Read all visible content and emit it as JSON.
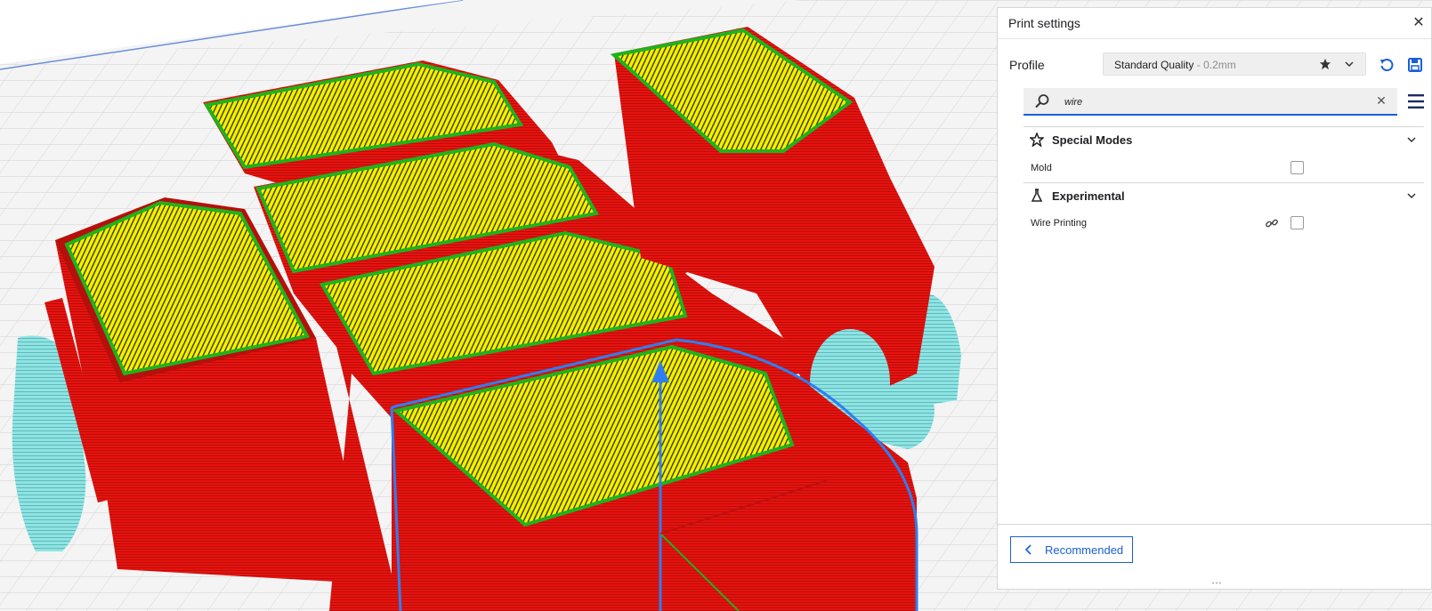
{
  "panel": {
    "title": "Print settings",
    "close_icon": "close-icon"
  },
  "profile": {
    "label": "Profile",
    "name": "Standard Quality",
    "sub": "- 0.2mm",
    "icons": [
      "star-icon",
      "chevron-down-icon",
      "reset-icon",
      "save-icon"
    ]
  },
  "search": {
    "value": "wire",
    "icon": "search-icon"
  },
  "sections": [
    {
      "title": "Special Modes",
      "icon": "star-outline-icon",
      "settings": [
        {
          "label": "Mold",
          "checked": false
        }
      ]
    },
    {
      "title": "Experimental",
      "icon": "flask-icon",
      "settings": [
        {
          "label": "Wire Printing",
          "checked": false,
          "linked": true
        }
      ]
    }
  ],
  "footer": {
    "recommended_label": "Recommended"
  },
  "colors": {
    "accent": "#1a5fd4",
    "wall": "#e3120f",
    "infill": "#f4f000",
    "skin_edge": "#1fb21f",
    "support": "#8fe3e3"
  }
}
